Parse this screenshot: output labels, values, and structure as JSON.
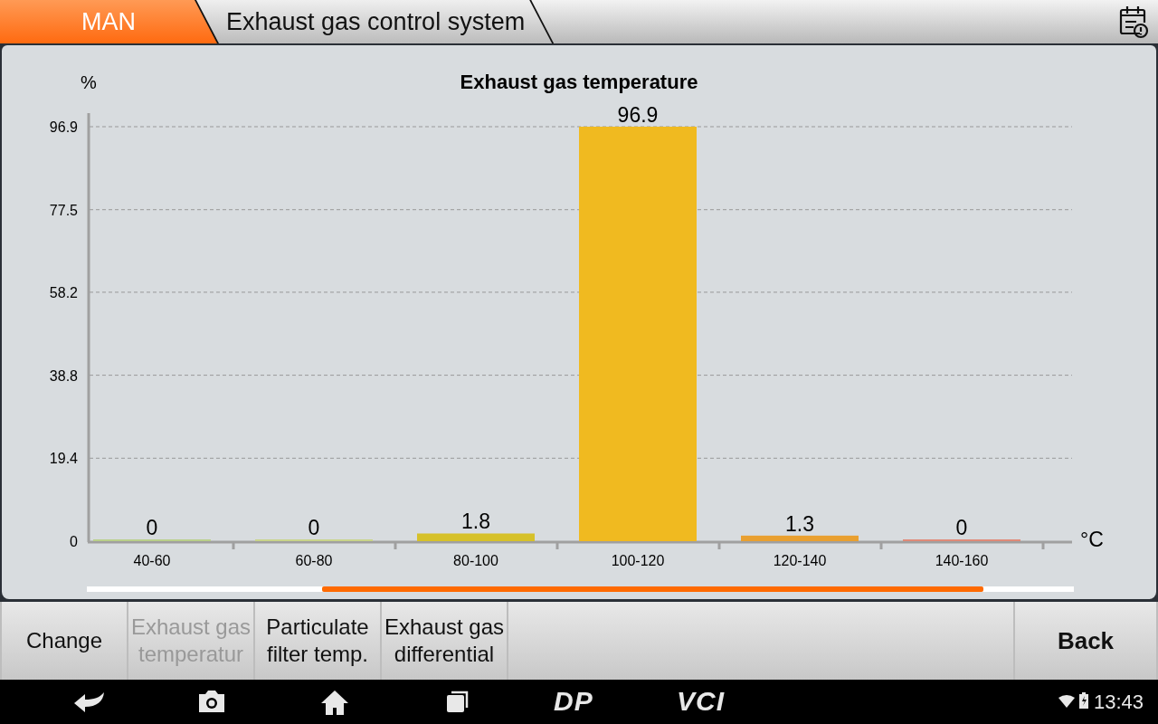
{
  "header": {
    "tabs": [
      {
        "label": "MAN",
        "selected": true
      },
      {
        "label": "Exhaust gas control system",
        "selected": false
      }
    ]
  },
  "chart": {
    "chart_data": {
      "type": "bar",
      "title": "Exhaust gas temperature",
      "ylabel": "%",
      "xlabel": "°C",
      "categories": [
        "40-60",
        "60-80",
        "80-100",
        "100-120",
        "120-140",
        "140-160"
      ],
      "series": [
        {
          "color": "#b9cf8a",
          "values": [
            0,
            null,
            null,
            null,
            null,
            null
          ]
        },
        {
          "color": "#c9d48a",
          "values": [
            null,
            0,
            null,
            null,
            null,
            null
          ]
        },
        {
          "color": "#d6c12a",
          "values": [
            null,
            null,
            1.8,
            null,
            null,
            null
          ]
        },
        {
          "color": "#f0ba20",
          "values": [
            null,
            null,
            null,
            96.9,
            null,
            null
          ]
        },
        {
          "color": "#e9a030",
          "values": [
            null,
            null,
            null,
            null,
            1.3,
            null
          ]
        },
        {
          "color": "#e08a78",
          "values": [
            null,
            null,
            null,
            null,
            null,
            0
          ]
        }
      ],
      "ylim": [
        0,
        96.9
      ],
      "yticks": [
        0,
        19.4,
        38.8,
        58.2,
        77.5,
        96.9
      ],
      "grid": true,
      "value_labels": [
        "0",
        "0",
        "1.8",
        "96.9",
        "1.3",
        "0"
      ]
    }
  },
  "buttons": [
    {
      "label": "Change",
      "disabled": false
    },
    {
      "label": "Exhaust gas temperatur",
      "disabled": true
    },
    {
      "label": "Particulate filter temp.",
      "disabled": false
    },
    {
      "label": "Exhaust gas differential",
      "disabled": false
    }
  ],
  "back_button": "Back",
  "nav_bar": {
    "logos": [
      "DP",
      "VCI"
    ],
    "time": "13:43"
  }
}
